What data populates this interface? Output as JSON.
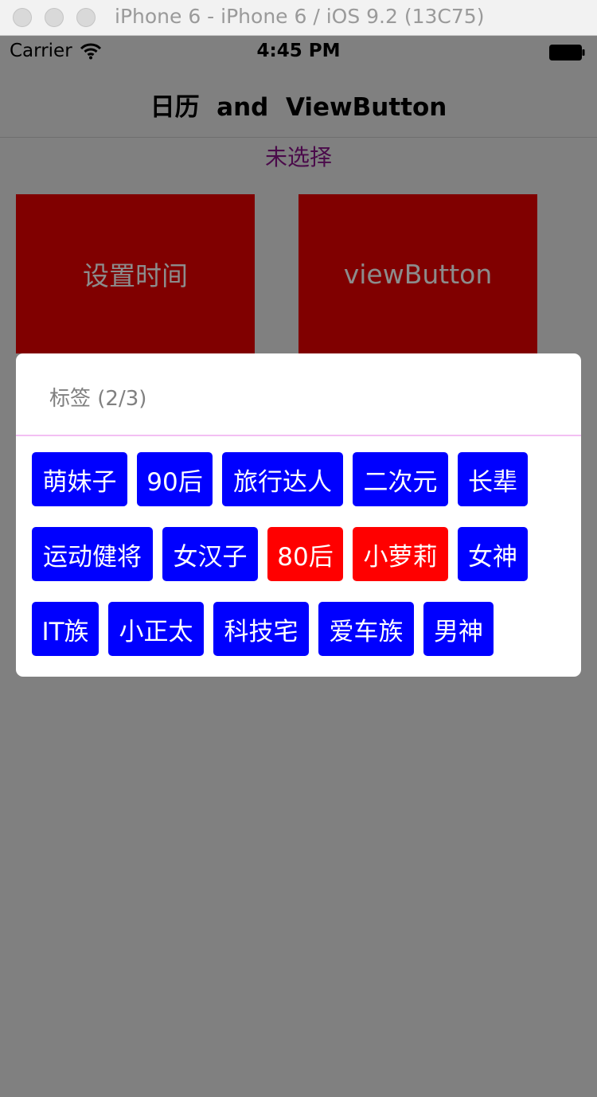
{
  "window": {
    "title": "iPhone 6 - iPhone 6 / iOS 9.2 (13C75)",
    "controls": [
      "close",
      "minimize",
      "zoom"
    ]
  },
  "status_bar": {
    "carrier": "Carrier",
    "time": "4:45 PM",
    "wifi_icon": "wifi-icon",
    "battery_icon": "battery-icon"
  },
  "nav": {
    "title": "日历  and  ViewButton"
  },
  "selection_label": "未选择",
  "buttons": {
    "set_time": "设置时间",
    "view_button": "viewButton",
    "bg_color": "#800000"
  },
  "tag_dialog": {
    "header": "标签 (2/3)",
    "selected_color": "#ff0000",
    "unselected_color": "#0000ff",
    "divider_color": "#f3bff3",
    "rows": [
      [
        {
          "label": "萌妹子",
          "selected": false
        },
        {
          "label": "90后",
          "selected": false
        },
        {
          "label": "旅行达人",
          "selected": false
        },
        {
          "label": "二次元",
          "selected": false
        },
        {
          "label": "长辈",
          "selected": false
        }
      ],
      [
        {
          "label": "运动健将",
          "selected": false
        },
        {
          "label": "女汉子",
          "selected": false
        },
        {
          "label": "80后",
          "selected": true
        },
        {
          "label": "小萝莉",
          "selected": true
        },
        {
          "label": "女神",
          "selected": false
        }
      ],
      [
        {
          "label": "IT族",
          "selected": false
        },
        {
          "label": "小正太",
          "selected": false
        },
        {
          "label": "科技宅",
          "selected": false
        },
        {
          "label": "爱车族",
          "selected": false
        },
        {
          "label": "男神",
          "selected": false
        }
      ]
    ]
  }
}
